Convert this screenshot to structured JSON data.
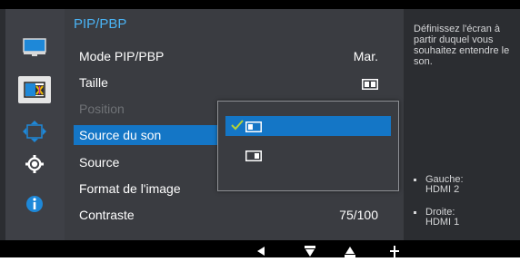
{
  "menu": {
    "title": "PIP/PBP",
    "items": [
      {
        "label": "Mode PIP/PBP",
        "value": "Mar.",
        "state": "normal"
      },
      {
        "label": "Taille",
        "value_icon": "pip-size-icon",
        "state": "normal"
      },
      {
        "label": "Position",
        "state": "disabled"
      },
      {
        "label": "Source du son",
        "state": "selected"
      },
      {
        "label": "Source",
        "state": "normal"
      },
      {
        "label": "Format de l'image",
        "state": "normal"
      },
      {
        "label": "Contraste",
        "value": "75/100",
        "state": "normal"
      }
    ]
  },
  "submenu": {
    "options": [
      {
        "icon": "main-screen-icon",
        "checked": true
      },
      {
        "icon": "sub-screen-icon",
        "checked": false
      }
    ]
  },
  "help": {
    "description": "Définissez l'écran à partir duquel vous souhaitez entendre le son.",
    "notes": [
      {
        "line1": "Gauche:",
        "line2": "HDMI 2"
      },
      {
        "line1": "Droite:",
        "line2": "HDMI 1"
      }
    ]
  },
  "nav": {
    "icons": [
      "monitor-icon",
      "pip-pbp-icon",
      "move-icon",
      "gear-icon",
      "info-icon"
    ],
    "selected": "pip-pbp-icon"
  },
  "colors": {
    "accent": "#1476c6",
    "title": "#4ab3f4",
    "check": "#b5d335"
  }
}
